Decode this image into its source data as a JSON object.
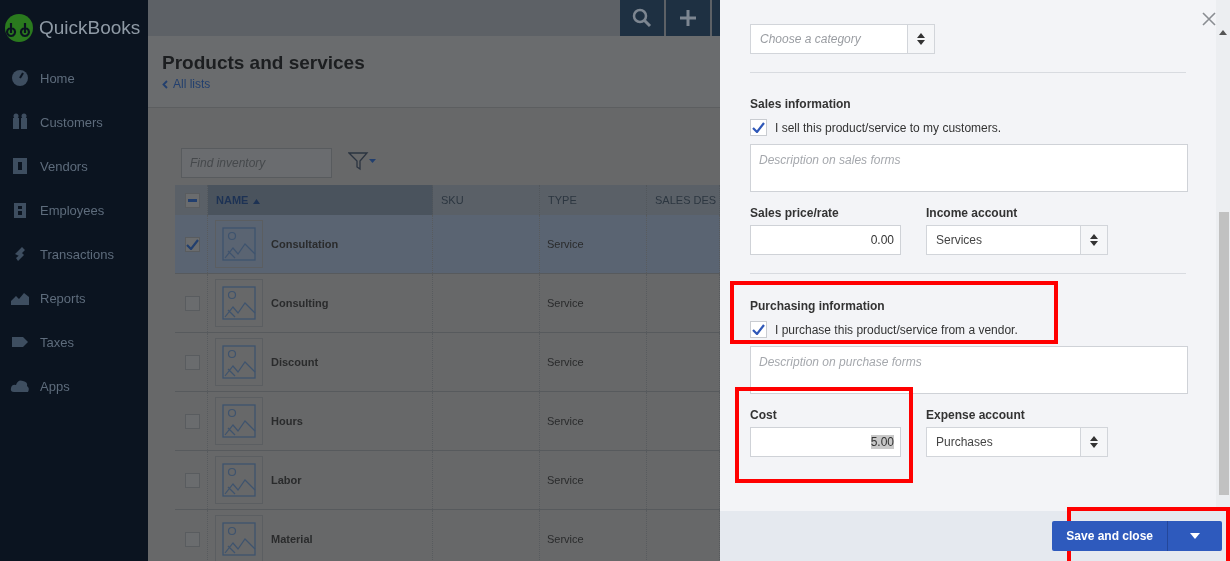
{
  "sidebar": {
    "logo": "QuickBooks",
    "items": [
      {
        "label": "Home"
      },
      {
        "label": "Customers"
      },
      {
        "label": "Vendors"
      },
      {
        "label": "Employees"
      },
      {
        "label": "Transactions"
      },
      {
        "label": "Reports"
      },
      {
        "label": "Taxes"
      },
      {
        "label": "Apps"
      }
    ]
  },
  "page": {
    "title": "Products and services",
    "back_link": "All lists"
  },
  "table": {
    "search": {
      "placeholder": "Find inventory"
    },
    "select_all": {
      "indeterminate": true
    },
    "columns": [
      {
        "label": "NAME",
        "sorted": true
      },
      {
        "label": "SKU",
        "sorted": false
      },
      {
        "label": "TYPE",
        "sorted": false
      },
      {
        "label": "SALES DES",
        "sorted": false
      }
    ],
    "rows": [
      {
        "name": "Consultation",
        "type": "Service",
        "checked": true,
        "selected": true
      },
      {
        "name": "Consulting",
        "type": "Service",
        "checked": false,
        "selected": false
      },
      {
        "name": "Discount",
        "type": "Service",
        "checked": false,
        "selected": false
      },
      {
        "name": "Hours",
        "type": "Service",
        "checked": false,
        "selected": false
      },
      {
        "name": "Labor",
        "type": "Service",
        "checked": false,
        "selected": false
      },
      {
        "name": "Material",
        "type": "Service",
        "checked": false,
        "selected": false
      }
    ]
  },
  "panel": {
    "category": {
      "placeholder": "Choose a category"
    },
    "sections": [
      {
        "title": "Sales information",
        "checkbox_label": "I sell this product/service to my customers.",
        "checked": true,
        "highlighted": false,
        "description": {
          "placeholder": "Description on sales forms"
        },
        "amount": {
          "label": "Sales price/rate",
          "value": "0.00",
          "text_selected": false,
          "highlighted": false
        },
        "account": {
          "label": "Income account",
          "value": "Services"
        }
      },
      {
        "title": "Purchasing information",
        "checkbox_label": "I purchase this product/service from a vendor.",
        "checked": true,
        "highlighted": true,
        "description": {
          "placeholder": "Description on purchase forms"
        },
        "amount": {
          "label": "Cost",
          "value": "5.00",
          "text_selected": true,
          "highlighted": true
        },
        "account": {
          "label": "Expense account",
          "value": "Purchases"
        }
      }
    ],
    "save_button": {
      "label": "Save and close",
      "highlighted": true
    }
  }
}
